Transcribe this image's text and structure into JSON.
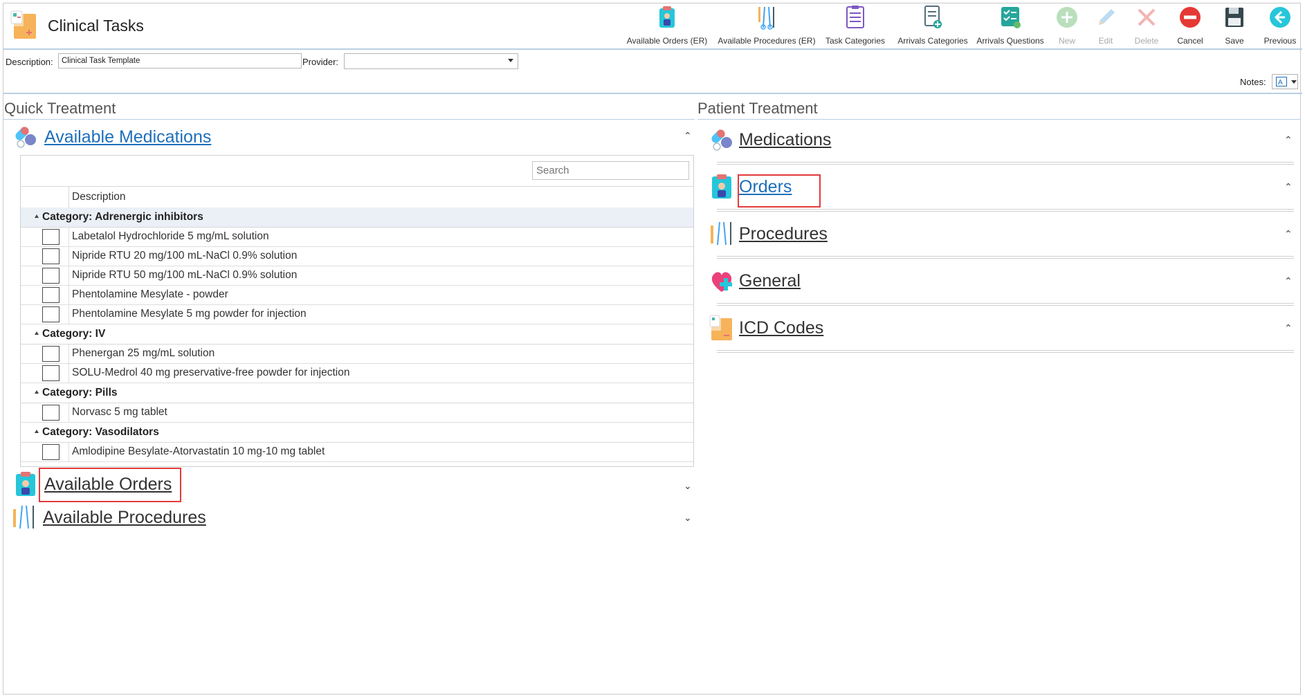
{
  "app": {
    "title": "Clinical Tasks",
    "icon": "clipboard-app-icon"
  },
  "toolbar": {
    "buttons": [
      {
        "label": "Available Orders (ER)",
        "icon": "orders-clipboard-icon",
        "enabled": true
      },
      {
        "label": "Available Procedures (ER)",
        "icon": "surgical-tools-icon",
        "enabled": true
      },
      {
        "label": "Task Categories",
        "icon": "task-list-icon",
        "enabled": true
      },
      {
        "label": "Arrivals Categories",
        "icon": "document-add-icon",
        "enabled": true
      },
      {
        "label": "Arrivals Questions",
        "icon": "checklist-icon",
        "enabled": true
      },
      {
        "label": "New",
        "icon": "plus-circle-icon",
        "enabled": false
      },
      {
        "label": "Edit",
        "icon": "pencil-icon",
        "enabled": false
      },
      {
        "label": "Delete",
        "icon": "x-icon",
        "enabled": false
      },
      {
        "label": "Cancel",
        "icon": "no-entry-icon",
        "enabled": true
      },
      {
        "label": "Save",
        "icon": "floppy-disk-icon",
        "enabled": true
      },
      {
        "label": "Previous",
        "icon": "back-arrow-icon",
        "enabled": true
      }
    ]
  },
  "form": {
    "description_label": "Description:",
    "description_value": "Clinical Task Template",
    "provider_label": "Provider:",
    "provider_value": "",
    "notes_label": "Notes:"
  },
  "quick_treatment": {
    "title": "Quick Treatment",
    "medications": {
      "label": "Available Medications",
      "search_placeholder": "Search",
      "column_header": "Description",
      "categories": [
        {
          "label": "Category: Adrenergic inhibitors",
          "items": [
            "Labetalol Hydrochloride 5 mg/mL solution",
            "Nipride RTU 20 mg/100 mL-NaCl 0.9% solution",
            "Nipride RTU 50 mg/100 mL-NaCl 0.9% solution",
            "Phentolamine Mesylate - powder",
            "Phentolamine Mesylate 5 mg powder for injection"
          ]
        },
        {
          "label": "Category: IV",
          "items": [
            "Phenergan 25 mg/mL solution",
            "SOLU-Medrol 40 mg preservative-free powder for injection"
          ]
        },
        {
          "label": "Category: Pills",
          "items": [
            "Norvasc 5 mg tablet"
          ]
        },
        {
          "label": "Category: Vasodilators",
          "items": [
            "Amlodipine Besylate-Atorvastatin 10 mg-10 mg tablet"
          ]
        }
      ]
    },
    "orders": {
      "label": "Available Orders"
    },
    "procedures": {
      "label": "Available Procedures"
    }
  },
  "patient_treatment": {
    "title": "Patient Treatment",
    "sections": [
      {
        "label": "Medications",
        "icon": "pills-icon"
      },
      {
        "label": "Orders",
        "icon": "orders-clipboard-icon"
      },
      {
        "label": "Procedures",
        "icon": "surgical-tools-icon"
      },
      {
        "label": "General",
        "icon": "heart-plus-icon"
      },
      {
        "label": "ICD Codes",
        "icon": "folder-chart-icon"
      }
    ]
  },
  "colors": {
    "accent_line": "#b8cfe4",
    "link_blue": "#1e6fba",
    "highlight_red": "#e23b3b",
    "category_bg": "#eaf0f6"
  }
}
